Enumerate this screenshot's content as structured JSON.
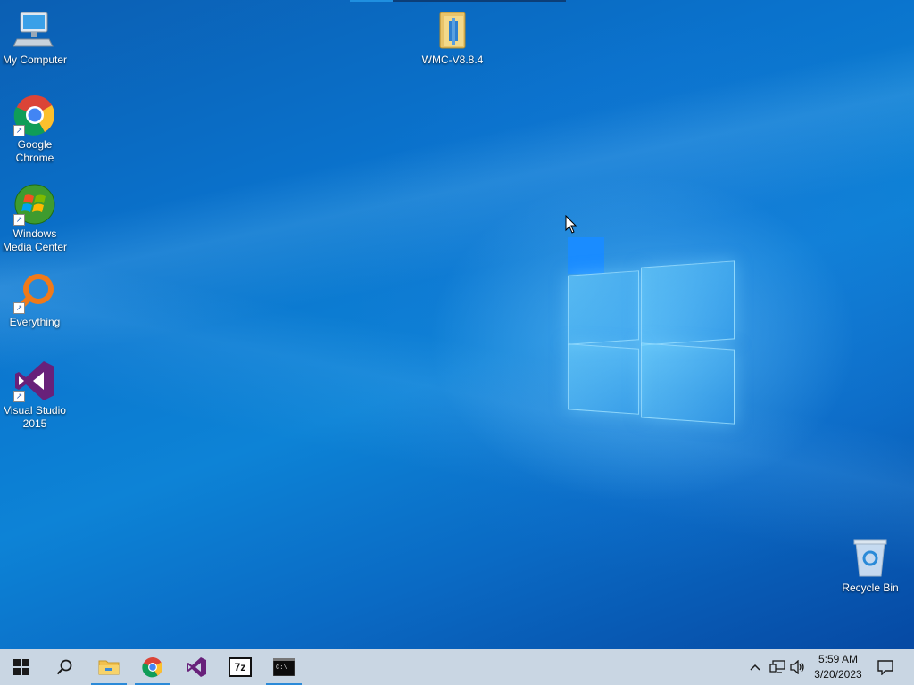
{
  "desktop": {
    "icons": [
      {
        "label": "My Computer",
        "icon": "my-computer-icon"
      },
      {
        "label": "Google Chrome",
        "icon": "chrome-icon"
      },
      {
        "label": "Windows Media Center",
        "icon": "windows-media-center-icon"
      },
      {
        "label": "Everything",
        "icon": "everything-search-icon"
      },
      {
        "label": "Visual Studio 2015",
        "icon": "visual-studio-icon"
      },
      {
        "label": "WMC-V8.8.4",
        "icon": "folder-icon"
      },
      {
        "label": "Recycle Bin",
        "icon": "recycle-bin-icon"
      }
    ]
  },
  "taskbar": {
    "buttons": [
      {
        "name": "start",
        "icon": "windows-start-icon"
      },
      {
        "name": "search",
        "icon": "search-icon"
      },
      {
        "name": "file-explorer",
        "icon": "file-explorer-icon",
        "active": true
      },
      {
        "name": "chrome",
        "icon": "chrome-icon",
        "active": true
      },
      {
        "name": "visual-studio",
        "icon": "visual-studio-icon"
      },
      {
        "name": "7zip",
        "icon": "7zip-icon",
        "glyph": "7z"
      },
      {
        "name": "terminal",
        "icon": "terminal-icon",
        "active": true
      }
    ],
    "clock": {
      "time": "5:59 AM",
      "date": "3/20/2023"
    }
  },
  "colors": {
    "accent": "#2b8ad8",
    "taskbar": "#c9d6e3",
    "desktop": "#0a72cc"
  }
}
